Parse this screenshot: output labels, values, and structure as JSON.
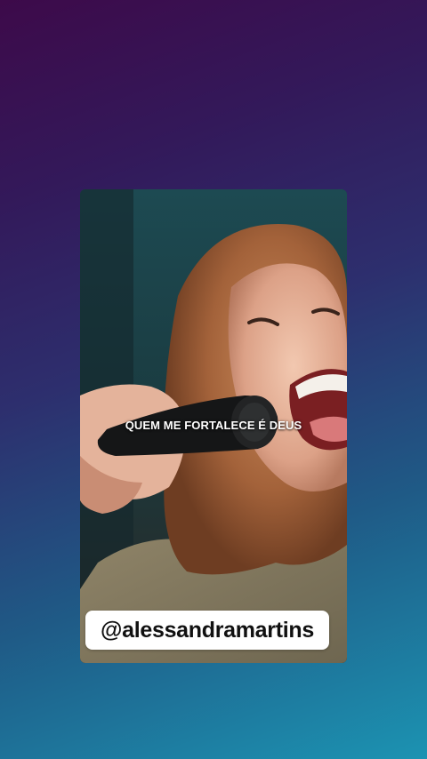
{
  "story": {
    "subtitle": "QUEM ME FORTALECE É DEUS",
    "mention": "@alessandramartins",
    "scene": "video-frame-singer"
  },
  "colors": {
    "background_top": "#3d0a4a",
    "background_bottom": "#1c93b2",
    "sticker_bg": "#ffffff",
    "sticker_text": "#111111",
    "subtitle_text": "#ffffff"
  }
}
